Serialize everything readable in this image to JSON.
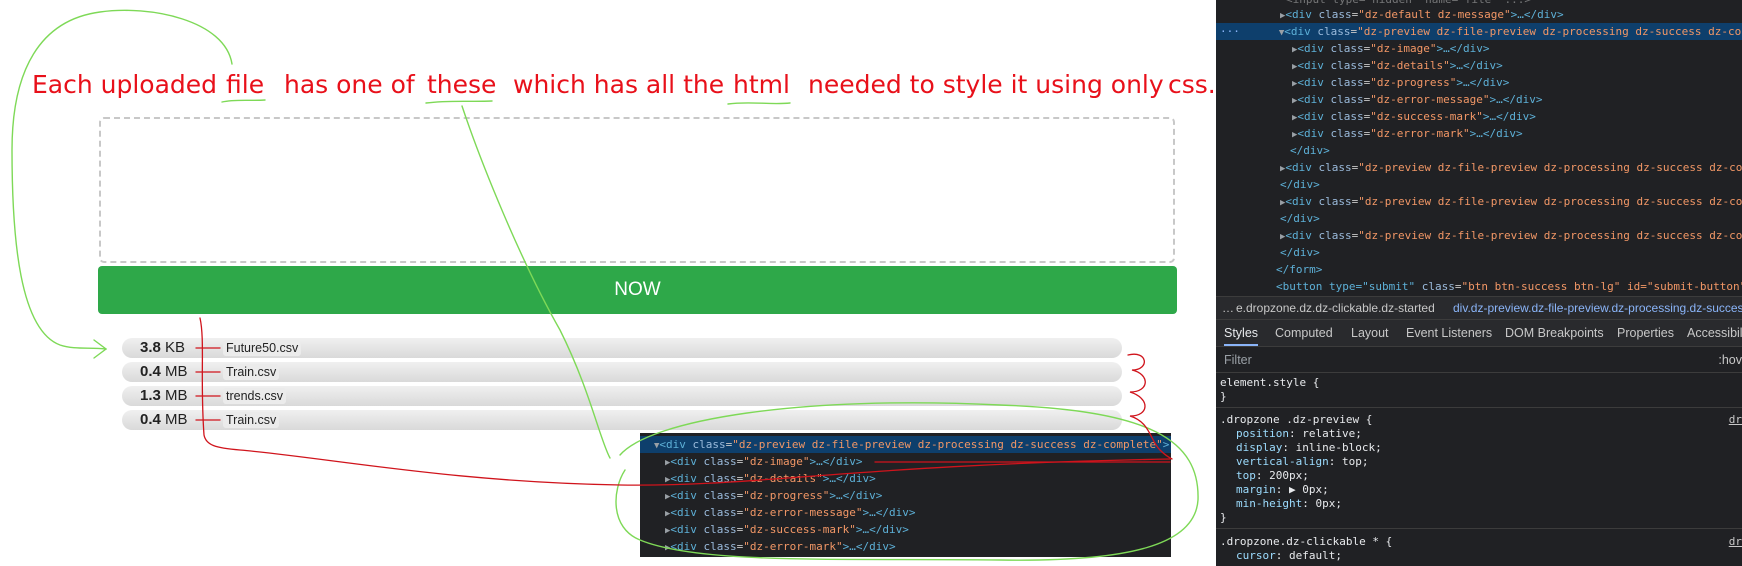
{
  "headline": {
    "words": [
      "Each uploaded",
      "file",
      "has one of",
      "these",
      "which has all the",
      "html",
      "needed to style it using only",
      "css."
    ]
  },
  "dropzone": {
    "button_label": "NOW"
  },
  "files": [
    {
      "size_value": "3.8",
      "size_unit": "KB",
      "name": "Future50.csv"
    },
    {
      "size_value": "0.4",
      "size_unit": "MB",
      "name": "Train.csv"
    },
    {
      "size_value": "1.3",
      "size_unit": "MB",
      "name": "trends.csv"
    },
    {
      "size_value": "0.4",
      "size_unit": "MB",
      "name": "Train.csv"
    }
  ],
  "snippet": {
    "lines": [
      {
        "open": "<div ",
        "attr": "class",
        "val": "\"dz-preview dz-file-preview dz-processing dz-success dz-complete\"",
        "close": ">"
      },
      {
        "open": "<div ",
        "attr": "class",
        "val": "\"dz-image\"",
        "close": ">…</div>"
      },
      {
        "open": "<div ",
        "attr": "class",
        "val": "\"dz-details\"",
        "close": ">…</div>"
      },
      {
        "open": "<div ",
        "attr": "class",
        "val": "\"dz-progress\"",
        "close": ">…</div>"
      },
      {
        "open": "<div ",
        "attr": "class",
        "val": "\"dz-error-message\"",
        "close": ">…</div>"
      },
      {
        "open": "<div ",
        "attr": "class",
        "val": "\"dz-success-mark\"",
        "close": ">…</div>"
      },
      {
        "open": "<div ",
        "attr": "class",
        "val": "\"dz-error-mark\"",
        "close": ">…</div>"
      }
    ]
  },
  "devtools": {
    "dom": {
      "partial_top": "<input type=\"hidden\" name=\"file\" ...>",
      "lines": [
        {
          "text_open": "<div ",
          "attr": "class",
          "val": "\"dz-default dz-message\"",
          "text_close": ">…</div>"
        },
        {
          "text_open": "<div ",
          "attr": "class",
          "val": "\"dz-preview dz-file-preview dz-processing dz-success dz-co",
          "text_close": ""
        },
        {
          "text_open": "<div ",
          "attr": "class",
          "val": "\"dz-image\"",
          "text_close": ">…</div>"
        },
        {
          "text_open": "<div ",
          "attr": "class",
          "val": "\"dz-details\"",
          "text_close": ">…</div>"
        },
        {
          "text_open": "<div ",
          "attr": "class",
          "val": "\"dz-progress\"",
          "text_close": ">…</div>"
        },
        {
          "text_open": "<div ",
          "attr": "class",
          "val": "\"dz-error-message\"",
          "text_close": ">…</div>"
        },
        {
          "text_open": "<div ",
          "attr": "class",
          "val": "\"dz-success-mark\"",
          "text_close": ">…</div>"
        },
        {
          "text_open": "<div ",
          "attr": "class",
          "val": "\"dz-error-mark\"",
          "text_close": ">…</div>"
        },
        {
          "text_open": "</div>",
          "attr": "",
          "val": "",
          "text_close": ""
        },
        {
          "text_open": "<div ",
          "attr": "class",
          "val": "\"dz-preview dz-file-preview dz-processing dz-success dz-co",
          "text_close": ""
        },
        {
          "text_open": "</div>",
          "attr": "",
          "val": "",
          "text_close": ""
        },
        {
          "text_open": "<div ",
          "attr": "class",
          "val": "\"dz-preview dz-file-preview dz-processing dz-success dz-co",
          "text_close": ""
        },
        {
          "text_open": "</div>",
          "attr": "",
          "val": "",
          "text_close": ""
        },
        {
          "text_open": "<div ",
          "attr": "class",
          "val": "\"dz-preview dz-file-preview dz-processing dz-success dz-co",
          "text_close": ""
        },
        {
          "text_open": "</div>",
          "attr": "",
          "val": "",
          "text_close": ""
        },
        {
          "text_open": "</form>",
          "attr": "",
          "val": "",
          "text_close": ""
        },
        {
          "text_open": "<button type=\"submit\" ",
          "attr": "class",
          "val": "\"btn btn-success btn-lg\" id=\"submit-button\"",
          "text_close": ""
        }
      ]
    },
    "selected_marker": "···",
    "breadcrumb": {
      "ellipsis": "…",
      "parent": "e.dropzone.dz.dz-clickable.dz-started",
      "active": "div.dz-preview.dz-file-preview.dz-processing.dz-success"
    },
    "tabs": [
      "Styles",
      "Computed",
      "Layout",
      "Event Listeners",
      "DOM Breakpoints",
      "Properties",
      "Accessibili"
    ],
    "filter": {
      "placeholder": "Filter",
      "hov": ":hov"
    },
    "rules": [
      {
        "selector": "element.style {",
        "source": "",
        "props": [],
        "close": "}"
      },
      {
        "selector": ".dropzone .dz-preview {",
        "source": "dr",
        "props": [
          {
            "name": "position",
            "value": "relative;"
          },
          {
            "name": "display",
            "value": "inline-block;"
          },
          {
            "name": "vertical-align",
            "value": "top;"
          },
          {
            "name": "top",
            "value": "200px;"
          },
          {
            "name": "margin",
            "value": "▶ 0px;"
          },
          {
            "name": "min-height",
            "value": "0px;"
          }
        ],
        "close": "}"
      },
      {
        "selector": ".dropzone.dz-clickable * {",
        "source": "dr",
        "props": [
          {
            "name": "cursor",
            "value": "default;"
          }
        ],
        "close": ""
      }
    ]
  },
  "colors": {
    "annotation_red": "#e8101a",
    "annotation_green": "#7ed957",
    "button_green": "#2ea849",
    "devtools_bg": "#202124",
    "devtools_selected": "#0e3f6c"
  }
}
